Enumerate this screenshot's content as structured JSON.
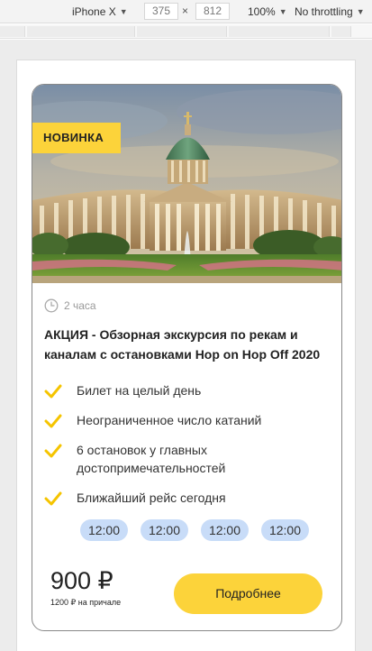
{
  "devtools": {
    "device": "iPhone X",
    "width": "375",
    "height": "812",
    "zoom": "100%",
    "throttling": "No throttling"
  },
  "card": {
    "badge": "НОВИНКА",
    "duration": "2 часа",
    "title": "АКЦИЯ - Обзорная экскурсия по рекам и каналам с остановками Hop on Hop Off 2020",
    "features": [
      "Билет на целый день",
      "Неограниченное число катаний",
      "6 остановок у главных достопримечательностей",
      "Ближайший рейс сегодня"
    ],
    "times": [
      "12:00",
      "12:00",
      "12:00",
      "12:00"
    ],
    "price": "900 ₽",
    "pier_price": "1200 ₽ на причале",
    "details_button": "Подробнее"
  },
  "colors": {
    "accent": "#fcd33a",
    "time_chip": "#c8dcf8",
    "check": "#f5c400"
  },
  "icons": {
    "duration": "clock-icon",
    "feature": "checkmark-icon"
  }
}
